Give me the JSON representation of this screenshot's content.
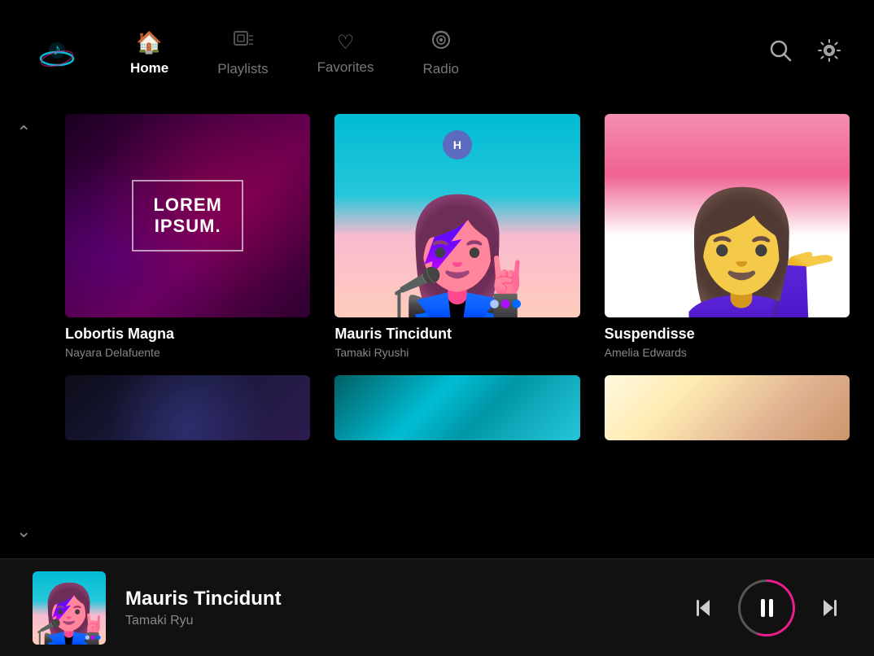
{
  "app": {
    "title": "Music App"
  },
  "nav": {
    "items": [
      {
        "id": "home",
        "label": "Home",
        "icon": "🏠",
        "active": true
      },
      {
        "id": "playlists",
        "label": "Playlists",
        "icon": "🎵",
        "active": false
      },
      {
        "id": "favorites",
        "label": "Favorites",
        "icon": "♡",
        "active": false
      },
      {
        "id": "radio",
        "label": "Radio",
        "icon": "📡",
        "active": false
      }
    ]
  },
  "cards": {
    "row1": [
      {
        "id": "card-1",
        "title": "Lobortis Magna",
        "artist": "Nayara Delafuente",
        "art_type": "lorem"
      },
      {
        "id": "card-2",
        "title": "Mauris Tincidunt",
        "artist": "Tamaki Ryushi",
        "art_type": "pink-hair"
      },
      {
        "id": "card-3",
        "title": "Suspendisse",
        "artist": "Amelia Edwards",
        "art_type": "woman-pink"
      }
    ],
    "row2": [
      {
        "id": "card-4",
        "art_type": "dark"
      },
      {
        "id": "card-5",
        "art_type": "teal"
      },
      {
        "id": "card-6",
        "art_type": "cream"
      }
    ]
  },
  "player": {
    "title": "Mauris Tincidunt",
    "artist": "Tamaki Ryu",
    "is_playing": true,
    "progress_deg": 200
  },
  "lorem_ipsum": {
    "line1": "LOREM",
    "line2": "IPSUM."
  }
}
